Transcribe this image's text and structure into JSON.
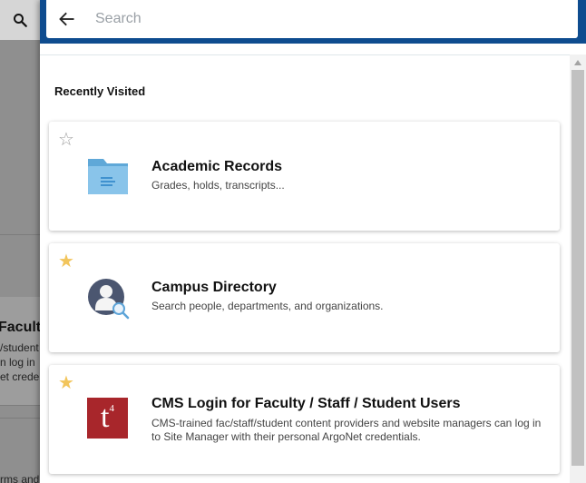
{
  "background": {
    "card_title": "Faculty",
    "card_lines": [
      "/student",
      "n log in",
      "et creden"
    ],
    "footer_text": "rms and"
  },
  "search": {
    "placeholder": "Search",
    "value": ""
  },
  "recent": {
    "heading": "Recently Visited",
    "items": [
      {
        "title": "Academic Records",
        "description": "Grades, holds, transcripts...",
        "favorite": false,
        "icon": "folder-icon"
      },
      {
        "title": "Campus Directory",
        "description": "Search people, departments, and organizations.",
        "favorite": true,
        "icon": "person-search-icon"
      },
      {
        "title": "CMS Login for Faculty / Staff / Student Users",
        "description": "CMS-trained fac/staff/student content providers and website managers can log in to Site Manager with their personal ArgoNet credentials.",
        "favorite": true,
        "icon": "t4-logo-icon",
        "icon_text": "t",
        "icon_sup": "4"
      }
    ]
  },
  "colors": {
    "header_blue": "#0e4c8f",
    "star_on": "#f2c55c",
    "star_off": "#9e9e9e",
    "t4_red": "#a8262b"
  }
}
